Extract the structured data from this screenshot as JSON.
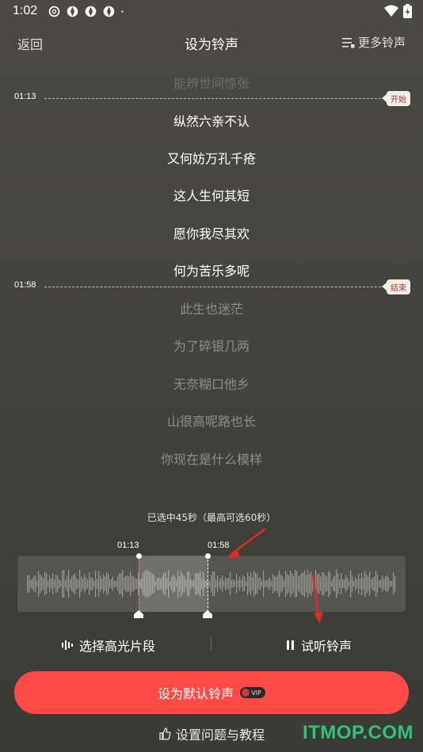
{
  "status": {
    "time": "1:02",
    "icons": [
      "netease-icon",
      "aperture-icon",
      "aperture-icon",
      "aperture-icon",
      "dot-icon"
    ],
    "right_icons": [
      "wifi-icon",
      "battery-icon"
    ]
  },
  "nav": {
    "back_label": "返回",
    "title": "设为铃声",
    "more_label": "更多铃声"
  },
  "lyrics": {
    "lines": [
      {
        "text": "能辨世间惊张",
        "state": "faded"
      },
      {
        "text": "纵然六亲不认",
        "state": "active"
      },
      {
        "text": "又何妨万孔千疮",
        "state": "active"
      },
      {
        "text": "这人生何其短",
        "state": "active"
      },
      {
        "text": "愿你我尽其欢",
        "state": "active"
      },
      {
        "text": "何为苦乐多呢",
        "state": "active"
      },
      {
        "text": "此生也迷茫",
        "state": "dim"
      },
      {
        "text": "为了碎银几两",
        "state": "dim"
      },
      {
        "text": "无奈糊口他乡",
        "state": "dim"
      },
      {
        "text": "山很高呢路也长",
        "state": "dim"
      },
      {
        "text": "你现在是什么模样",
        "state": "dim"
      }
    ],
    "start_marker": {
      "time": "01:13",
      "tag": "开始"
    },
    "end_marker": {
      "time": "01:58",
      "tag": "结束"
    }
  },
  "selection": {
    "info": "已选中45秒（最高可选60秒）",
    "start_time": "01:13",
    "end_time": "01:58"
  },
  "actions": {
    "highlight_label": "选择高光片段",
    "preview_label": "试听铃声"
  },
  "cta": {
    "label": "设为默认铃声",
    "badge": "VIP"
  },
  "help": {
    "label": "设置问题与教程"
  },
  "watermark": "ITMOP.COM",
  "colors": {
    "accent": "#ff4a46",
    "tag_text": "#b0302a",
    "watermark": "#2ec27a"
  }
}
